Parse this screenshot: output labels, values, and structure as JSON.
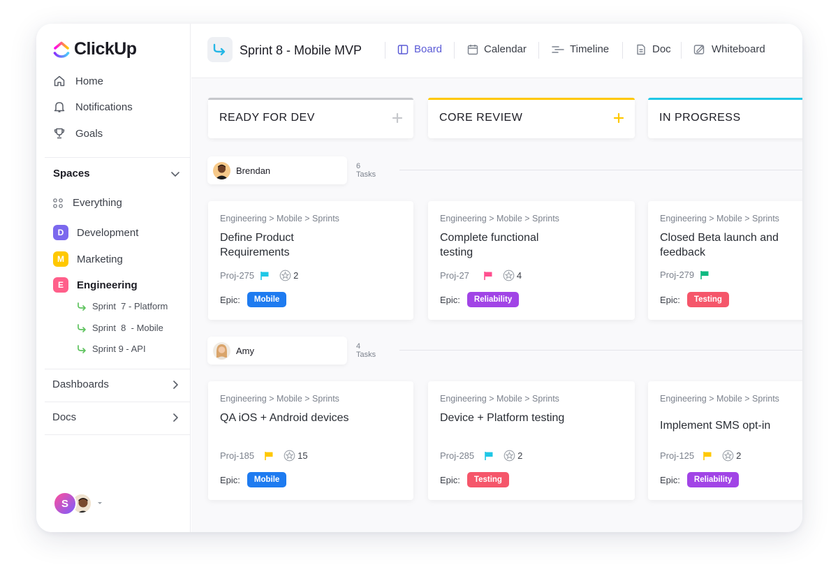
{
  "app": {
    "name": "ClickUp"
  },
  "sidebar": {
    "nav": [
      {
        "label": "Home",
        "icon": "home-icon"
      },
      {
        "label": "Notifications",
        "icon": "bell-icon"
      },
      {
        "label": "Goals",
        "icon": "trophy-icon"
      }
    ],
    "spaces_label": "Spaces",
    "everything_label": "Everything",
    "spaces": [
      {
        "letter": "D",
        "label": "Development",
        "color": "#7b68ee"
      },
      {
        "letter": "M",
        "label": "Marketing",
        "color": "#ffc800"
      },
      {
        "letter": "E",
        "label": "Engineering",
        "color": "#ff5f8a"
      }
    ],
    "sprints": [
      "Sprint  7 - Platform",
      "Sprint  8  - Mobile",
      "Sprint 9 - API"
    ],
    "dashboards_label": "Dashboards",
    "docs_label": "Docs",
    "user_initial": "S"
  },
  "header": {
    "title": "Sprint 8 - Mobile MVP",
    "tabs": [
      {
        "label": "Board",
        "icon": "board-icon"
      },
      {
        "label": "Calendar",
        "icon": "calendar-icon"
      },
      {
        "label": "Timeline",
        "icon": "timeline-icon"
      },
      {
        "label": "Doc",
        "icon": "doc-icon"
      },
      {
        "label": "Whiteboard",
        "icon": "whiteboard-icon"
      }
    ]
  },
  "columns": [
    {
      "title": "READY FOR DEV",
      "color": "#c6c8cc"
    },
    {
      "title": "CORE REVIEW",
      "color": "#ffc800"
    },
    {
      "title": "IN PROGRESS",
      "color": "#1fc7e6"
    }
  ],
  "colors": {
    "accent": "#5b5bd6",
    "mobile": "#1e7bf0",
    "reliability": "#a144e6",
    "testing": "#f5566a"
  },
  "groups": [
    {
      "name": "Brendan",
      "count": "6 Tasks",
      "cards": [
        {
          "crumb": "Engineering > Mobile > Sprints",
          "title": "Define Product Requirements",
          "id": "Proj-275",
          "flag": "#1fc7e6",
          "points": "2",
          "epic_label": "Epic:",
          "tag": "Mobile",
          "tag_color": "#1e7bf0"
        },
        {
          "crumb": "Engineering > Mobile > Sprints",
          "title": "Complete functional testing",
          "id": "Proj-27",
          "flag": "#ff4f8f",
          "points": "4",
          "epic_label": "Epic:",
          "tag": "Reliability",
          "tag_color": "#a144e6"
        },
        {
          "crumb": "Engineering > Mobile > Sprints",
          "title": "Closed Beta launch and feedback",
          "id": "Proj-279",
          "flag": "#10b981",
          "points": "",
          "epic_label": "Epic:",
          "tag": "Testing",
          "tag_color": "#f5566a"
        }
      ]
    },
    {
      "name": "Amy",
      "count": "4 Tasks",
      "cards": [
        {
          "crumb": "Engineering > Mobile > Sprints",
          "title": "QA iOS + Android devices",
          "id": "Proj-185",
          "flag": "#ffc800",
          "points": "15",
          "epic_label": "Epic:",
          "tag": "Mobile",
          "tag_color": "#1e7bf0"
        },
        {
          "crumb": "Engineering > Mobile > Sprints",
          "title": "Device + Platform testing",
          "id": "Proj-285",
          "flag": "#1fc7e6",
          "points": "2",
          "epic_label": "Epic:",
          "tag": "Testing",
          "tag_color": "#f5566a"
        },
        {
          "crumb": "Engineering > Mobile > Sprints",
          "title": "Implement SMS opt-in",
          "id": "Proj-125",
          "flag": "#ffc800",
          "points": "2",
          "epic_label": "Epic:",
          "tag": "Reliability",
          "tag_color": "#a144e6"
        }
      ]
    }
  ]
}
